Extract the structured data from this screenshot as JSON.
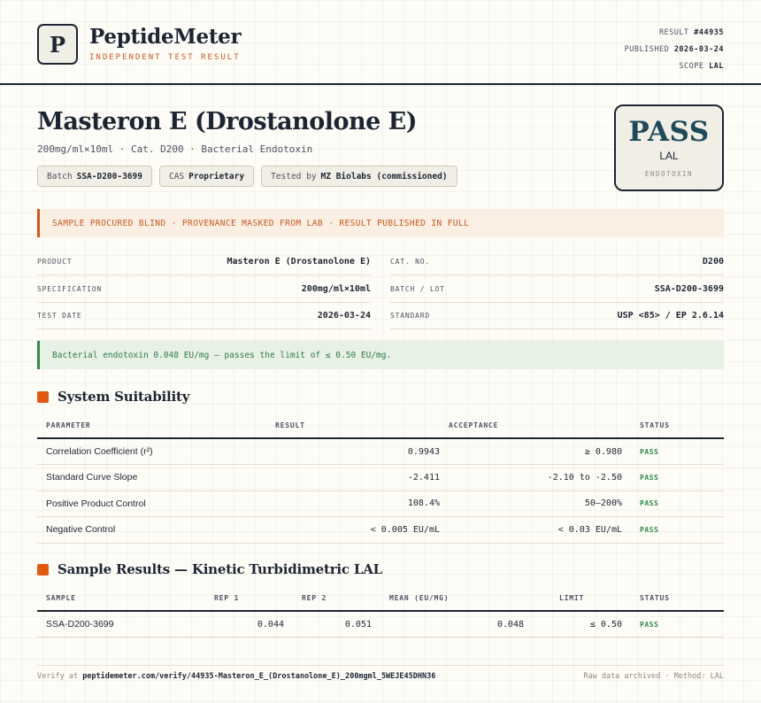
{
  "header": {
    "logo_letter": "P",
    "brand": "PeptideMeter",
    "brand_sub": "INDEPENDENT TEST RESULT",
    "result_label": "RESULT",
    "result_value": "#44935",
    "published_label": "PUBLISHED",
    "published_value": "2026-03-24",
    "scope_label": "SCOPE",
    "scope_value": "LAL"
  },
  "product": {
    "title": "Masteron E (Drostanolone E)",
    "subtitle": "200mg/ml×10ml · Cat. D200 · Bacterial Endotoxin",
    "chips": [
      {
        "label": "Batch",
        "value": "SSA-D200-3699"
      },
      {
        "label": "CAS",
        "value": "Proprietary"
      },
      {
        "label": "Tested by",
        "value": "MZ Biolabs (commissioned)"
      }
    ]
  },
  "verdict": {
    "status": "PASS",
    "scope": "LAL",
    "category": "ENDOTOXIN"
  },
  "notice": "SAMPLE PROCURED BLIND · PROVENANCE MASKED FROM LAB · RESULT PUBLISHED IN FULL",
  "info_left": [
    {
      "key": "PRODUCT",
      "value": "Masteron E (Drostanolone E)"
    },
    {
      "key": "SPECIFICATION",
      "value": "200mg/ml×10ml"
    },
    {
      "key": "TEST DATE",
      "value": "2026-03-24"
    }
  ],
  "info_right": [
    {
      "key": "CAT. NO.",
      "value": "D200"
    },
    {
      "key": "BATCH / LOT",
      "value": "SSA-D200-3699"
    },
    {
      "key": "STANDARD",
      "value": "USP <85> / EP 2.6.14"
    }
  ],
  "summary": "Bacterial endotoxin 0.048 EU/mg — passes the limit of ≤ 0.50 EU/mg.",
  "suitability": {
    "title": "System Suitability",
    "headers": [
      "PARAMETER",
      "RESULT",
      "ACCEPTANCE",
      "STATUS"
    ],
    "rows": [
      {
        "parameter": "Correlation Coefficient (r²)",
        "result": "0.9943",
        "acceptance": "≥ 0.980",
        "status": "PASS"
      },
      {
        "parameter": "Standard Curve Slope",
        "result": "-2.411",
        "acceptance": "-2.10 to -2.50",
        "status": "PASS"
      },
      {
        "parameter": "Positive Product Control",
        "result": "108.4%",
        "acceptance": "50–200%",
        "status": "PASS"
      },
      {
        "parameter": "Negative Control",
        "result": "< 0.005 EU/mL",
        "acceptance": "< 0.03 EU/mL",
        "status": "PASS"
      }
    ]
  },
  "samples": {
    "title": "Sample Results — Kinetic Turbidimetric LAL",
    "headers": [
      "SAMPLE",
      "REP 1",
      "REP 2",
      "MEAN (EU/MG)",
      "LIMIT",
      "STATUS"
    ],
    "rows": [
      {
        "sample": "SSA-D200-3699",
        "rep1": "0.044",
        "rep2": "0.051",
        "mean": "0.048",
        "limit": "≤ 0.50",
        "status": "PASS"
      }
    ]
  },
  "footer": {
    "verify_label": "Verify at",
    "verify_url": "peptidemeter.com/verify/44935-Masteron_E_(Drostanolone_E)_200mgml_5WEJE45DHN36",
    "right": "Raw data archived · Method: LAL"
  }
}
